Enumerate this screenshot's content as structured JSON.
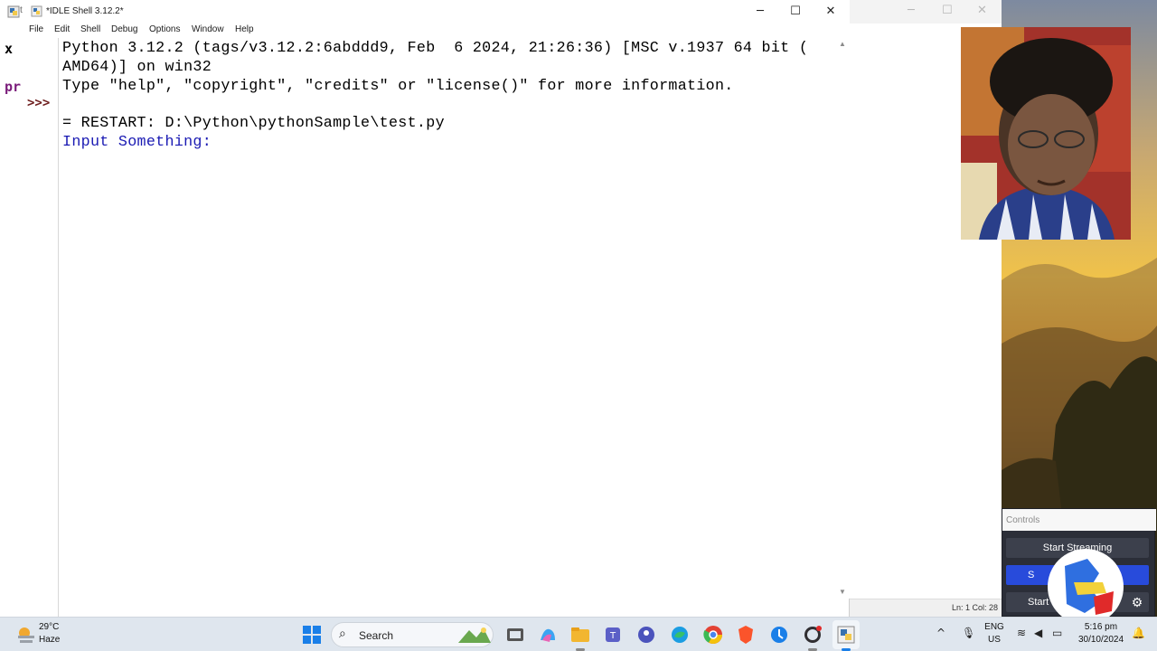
{
  "window": {
    "title": "*IDLE Shell 3.12.2*",
    "minimize": "─",
    "maximize": "☐",
    "close": "✕"
  },
  "background_window": {
    "title_fragment": "t",
    "left_text_1": "x",
    "left_text_2": "pr",
    "status": "Ln: 1   Col: 28"
  },
  "menu": [
    {
      "label": "File"
    },
    {
      "label": "Edit"
    },
    {
      "label": "Shell"
    },
    {
      "label": "Debug"
    },
    {
      "label": "Options"
    },
    {
      "label": "Window"
    },
    {
      "label": "Help"
    }
  ],
  "shell": {
    "prompt": ">>>",
    "lines": [
      "Python 3.12.2 (tags/v3.12.2:6abddd9, Feb  6 2024, 21:26:36) [MSC v.1937 64 bit (",
      "AMD64)] on win32",
      "Type \"help\", \"copyright\", \"credits\" or \"license()\" for more information.",
      "= RESTART: D:\\Python\\pythonSample\\test.py",
      "Input Something: "
    ]
  },
  "controls_panel": {
    "header": "Controls",
    "start_streaming": "Start Streaming",
    "start_recording_fragment": "S",
    "start_virtual_fragment": "Start V",
    "gear_icon": "gear-icon"
  },
  "taskbar": {
    "weather_temp": "29°C",
    "weather_cond": "Haze",
    "search_label": "Search",
    "lang_1": "ENG",
    "lang_2": "US",
    "time": "5:16 pm",
    "date": "30/10/2024",
    "icons": [
      "windows-start-icon",
      "search-icon",
      "task-view-icon",
      "copilot-icon",
      "file-explorer-icon",
      "teams-icon",
      "teams-work-icon",
      "edge-icon",
      "chrome-icon",
      "brave-icon",
      "app-icon",
      "obs-icon",
      "idle-icon"
    ]
  },
  "colors": {
    "shell_output_blue": "#1a1ab3",
    "prompt_color": "#6e1e1e",
    "taskbar_bg": "#dfe6ee",
    "controls_accent": "#284bdb"
  }
}
